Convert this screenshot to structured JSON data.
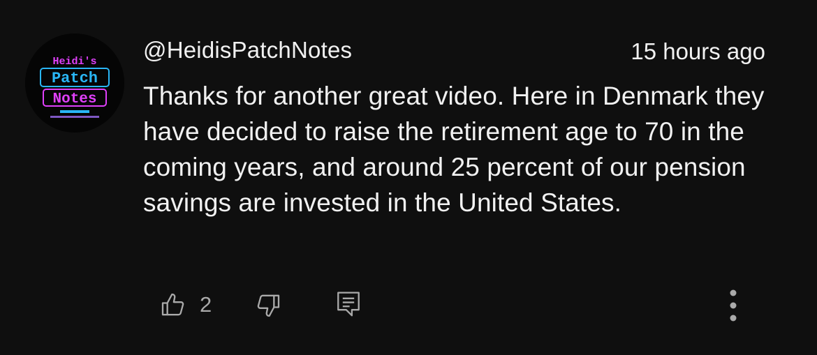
{
  "comment": {
    "author": "@HeidisPatchNotes",
    "timestamp": "15 hours ago",
    "text": "Thanks for another great video. Here in Denmark they have decided to raise the retirement age to 70 in the coming years, and around 25 percent of our pension savings are invested in the United States.",
    "avatar": {
      "line1": "Heidi's",
      "line2": "Patch",
      "line3": "Notes",
      "colors": {
        "neon_blue": "#29b6f6",
        "neon_pink": "#e040fb",
        "background": "#050505"
      }
    },
    "actions": {
      "like_count": "2",
      "like_icon": "thumbs-up-icon",
      "dislike_icon": "thumbs-down-icon",
      "reply_icon": "comment-reply-icon",
      "more_icon": "more-vertical-icon"
    }
  },
  "colors": {
    "background": "#0f0f0f",
    "text_primary": "#f1f1f1",
    "text_secondary": "#aaaaaa",
    "icon": "#aaaaaa"
  }
}
